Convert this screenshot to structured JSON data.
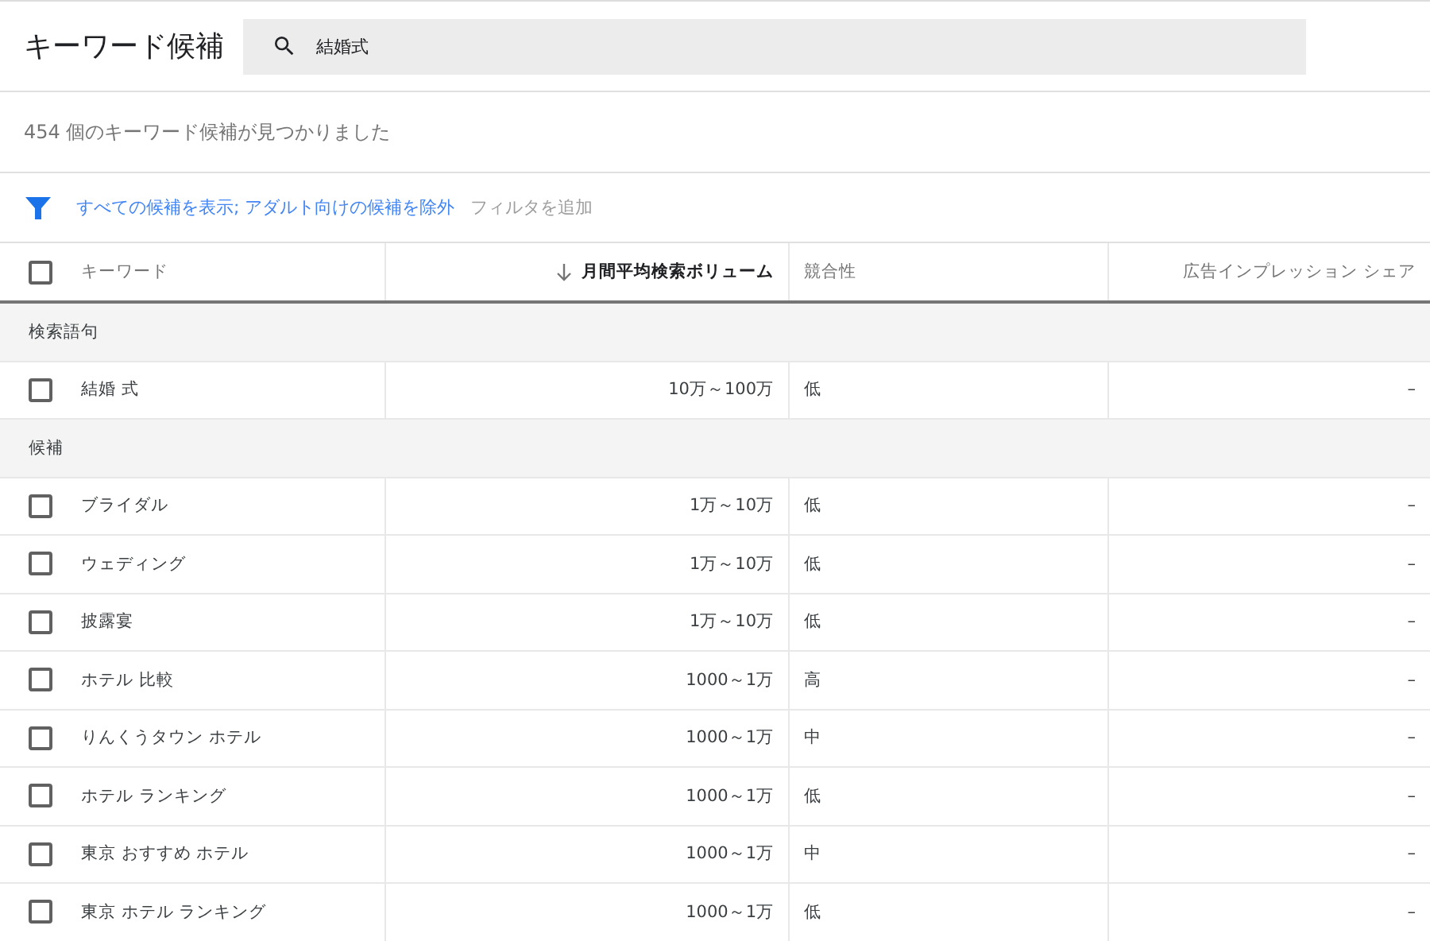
{
  "header": {
    "title": "キーワード候補",
    "search": {
      "value": "結婚式"
    }
  },
  "result_count": "454 個のキーワード候補が見つかりました",
  "filter_bar": {
    "active_filter": "すべての候補を表示; アダルト向けの候補を除外",
    "add_filter": "フィルタを追加"
  },
  "table": {
    "select_all": {
      "checked": false
    },
    "columns": [
      {
        "label": "キーワード",
        "sorted": false
      },
      {
        "label": "月間平均検索ボリューム",
        "sorted": true
      },
      {
        "label": "競合性",
        "sorted": false
      },
      {
        "label": "広告インプレッション シェア",
        "sorted": false
      }
    ],
    "groups": [
      {
        "label": "検索語句",
        "rows": [
          {
            "keyword": "結婚 式",
            "volume": "10万～100万",
            "competition": "低",
            "share": "–",
            "checked": false
          }
        ]
      },
      {
        "label": "候補",
        "rows": [
          {
            "keyword": "ブライダル",
            "volume": "1万～10万",
            "competition": "低",
            "share": "–",
            "checked": false
          },
          {
            "keyword": "ウェディング",
            "volume": "1万～10万",
            "competition": "低",
            "share": "–",
            "checked": false
          },
          {
            "keyword": "披露宴",
            "volume": "1万～10万",
            "competition": "低",
            "share": "–",
            "checked": false
          },
          {
            "keyword": "ホテル 比較",
            "volume": "1000～1万",
            "competition": "高",
            "share": "–",
            "checked": false
          },
          {
            "keyword": "りんくうタウン ホテル",
            "volume": "1000～1万",
            "competition": "中",
            "share": "–",
            "checked": false
          },
          {
            "keyword": "ホテル ランキング",
            "volume": "1000～1万",
            "competition": "低",
            "share": "–",
            "checked": false
          },
          {
            "keyword": "東京 おすすめ ホテル",
            "volume": "1000～1万",
            "competition": "中",
            "share": "–",
            "checked": false
          },
          {
            "keyword": "東京 ホテル ランキング",
            "volume": "1000～1万",
            "competition": "低",
            "share": "–",
            "checked": false
          }
        ]
      }
    ]
  }
}
